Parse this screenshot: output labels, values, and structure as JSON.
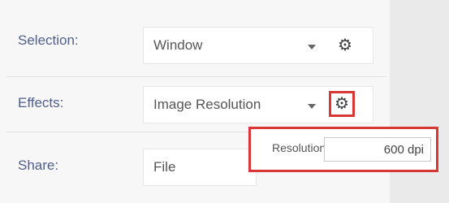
{
  "rows": [
    {
      "label": "Selection:",
      "value": "Window"
    },
    {
      "label": "Effects:",
      "value": "Image Resolution"
    },
    {
      "label": "Share:",
      "value": "File"
    }
  ],
  "popup": {
    "label": "Resolution:",
    "value": "600 dpi"
  },
  "colors": {
    "label": "#4f5f8a",
    "highlight": "#d93636"
  },
  "icons": {
    "settings": "gear-icon",
    "dropdown": "chevron-down-icon"
  }
}
